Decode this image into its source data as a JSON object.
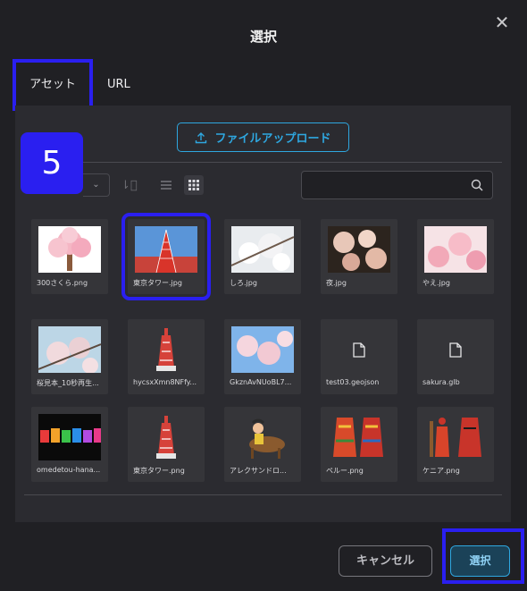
{
  "dialog": {
    "title": "選択",
    "close_icon": "close-icon"
  },
  "tabs": [
    {
      "label": "アセット",
      "active": true
    },
    {
      "label": "URL",
      "active": false
    }
  ],
  "upload": {
    "label": "ファイルアップロード",
    "icon": "upload-icon"
  },
  "step_badge": "5",
  "toolbar": {
    "sort_icon": "sort-icon",
    "list_view_icon": "list-view-icon",
    "grid_view_icon": "grid-view-icon",
    "search": {
      "value": "",
      "placeholder": "",
      "icon": "search-icon"
    }
  },
  "files": [
    {
      "name": "300さくら.png",
      "kind": "image",
      "art": "tree"
    },
    {
      "name": "東京タワー.jpg",
      "kind": "image",
      "art": "tower-photo",
      "selected": true
    },
    {
      "name": "しろ.jpg",
      "kind": "image",
      "art": "white-blossom"
    },
    {
      "name": "夜.jpg",
      "kind": "image",
      "art": "night-blossom"
    },
    {
      "name": "やえ.jpg",
      "kind": "image",
      "art": "pink-blossom"
    },
    {
      "name": "桜見本_10秒再生...",
      "kind": "image",
      "art": "sky-blossom"
    },
    {
      "name": "hycsxXmn8NFfy...",
      "kind": "image",
      "art": "tower-icon"
    },
    {
      "name": "GkznAvNUoBL7...",
      "kind": "image",
      "art": "blue-blossom"
    },
    {
      "name": "test03.geojson",
      "kind": "file",
      "art": "file-icon"
    },
    {
      "name": "sakura.glb",
      "kind": "file",
      "art": "file-icon"
    },
    {
      "name": "omedetou-hana...",
      "kind": "image",
      "art": "omedetou"
    },
    {
      "name": "東京タワー.png",
      "kind": "image",
      "art": "tower-icon"
    },
    {
      "name": "アレクサンドロ...",
      "kind": "image",
      "art": "rider"
    },
    {
      "name": "ペルー.png",
      "kind": "image",
      "art": "costume-red"
    },
    {
      "name": "ケニア.png",
      "kind": "image",
      "art": "costume-kenya"
    }
  ],
  "footer": {
    "cancel_label": "キャンセル",
    "select_label": "選択"
  },
  "colors": {
    "accent": "#2ea7e0",
    "highlight": "#2a1ff0",
    "background": "#202024",
    "panel": "#2b2b30"
  }
}
